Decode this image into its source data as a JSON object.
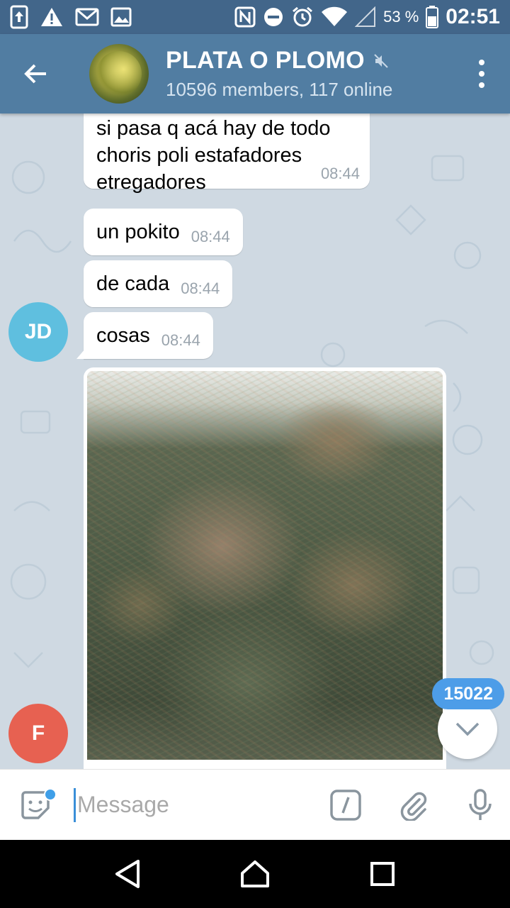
{
  "status_bar": {
    "battery_pct": "53 %",
    "time": "02:51"
  },
  "header": {
    "title": "PLATA O PLOMO",
    "subtitle": "10596 members, 117 online"
  },
  "messages": [
    {
      "text_lines": [
        "si pasa q acá hay de todo",
        "choris poli estafadores",
        "etregadores"
      ],
      "time": "08:44"
    },
    {
      "text": "un pokito",
      "time": "08:44"
    },
    {
      "text": "de cada",
      "time": "08:44"
    },
    {
      "text": "cosas",
      "time": "08:44"
    }
  ],
  "avatars": {
    "jd": "JD",
    "f": "F"
  },
  "unread_count": "15022",
  "input": {
    "placeholder": "Message"
  },
  "colors": {
    "header": "#517da2",
    "status_bar": "#42668a",
    "chat_bg": "#cfd9e2",
    "avatar_jd": "#5fbfdf",
    "avatar_f": "#e76151",
    "badge": "#4d9de8"
  }
}
